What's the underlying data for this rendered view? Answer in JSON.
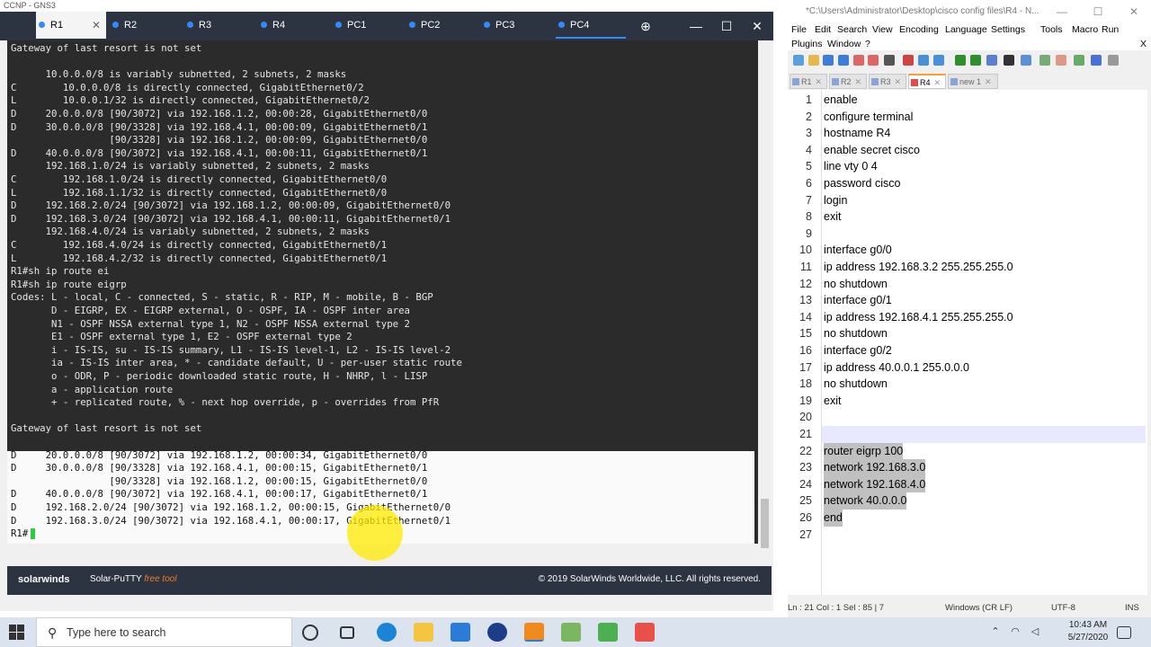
{
  "putty": {
    "window_title": "CCNP - GNS3",
    "tabs": [
      {
        "label": "R1",
        "active": true
      },
      {
        "label": "R2"
      },
      {
        "label": "R3"
      },
      {
        "label": "R4"
      },
      {
        "label": "PC1"
      },
      {
        "label": "PC2"
      },
      {
        "label": "PC3"
      },
      {
        "label": "PC4"
      }
    ],
    "add_tab": "⊕",
    "min": "—",
    "max": "☐",
    "close": "✕",
    "terminal_lines": [
      "Gateway of last resort is not set",
      "",
      "      10.0.0.0/8 is variably subnetted, 2 subnets, 2 masks",
      "C        10.0.0.0/8 is directly connected, GigabitEthernet0/2",
      "L        10.0.0.1/32 is directly connected, GigabitEthernet0/2",
      "D     20.0.0.0/8 [90/3072] via 192.168.1.2, 00:00:28, GigabitEthernet0/0",
      "D     30.0.0.0/8 [90/3328] via 192.168.4.1, 00:00:09, GigabitEthernet0/1",
      "                 [90/3328] via 192.168.1.2, 00:00:09, GigabitEthernet0/0",
      "D     40.0.0.0/8 [90/3072] via 192.168.4.1, 00:00:11, GigabitEthernet0/1",
      "      192.168.1.0/24 is variably subnetted, 2 subnets, 2 masks",
      "C        192.168.1.0/24 is directly connected, GigabitEthernet0/0",
      "L        192.168.1.1/32 is directly connected, GigabitEthernet0/0",
      "D     192.168.2.0/24 [90/3072] via 192.168.1.2, 00:00:09, GigabitEthernet0/0",
      "D     192.168.3.0/24 [90/3072] via 192.168.4.1, 00:00:11, GigabitEthernet0/1",
      "      192.168.4.0/24 is variably subnetted, 2 subnets, 2 masks",
      "C        192.168.4.0/24 is directly connected, GigabitEthernet0/1",
      "L        192.168.4.2/32 is directly connected, GigabitEthernet0/1",
      "R1#sh ip route ei",
      "R1#sh ip route eigrp",
      "Codes: L - local, C - connected, S - static, R - RIP, M - mobile, B - BGP",
      "       D - EIGRP, EX - EIGRP external, O - OSPF, IA - OSPF inter area",
      "       N1 - OSPF NSSA external type 1, N2 - OSPF NSSA external type 2",
      "       E1 - OSPF external type 1, E2 - OSPF external type 2",
      "       i - IS-IS, su - IS-IS summary, L1 - IS-IS level-1, L2 - IS-IS level-2",
      "       ia - IS-IS inter area, * - candidate default, U - per-user static route",
      "       o - ODR, P - periodic downloaded static route, H - NHRP, l - LISP",
      "       a - application route",
      "       + - replicated route, % - next hop override, p - overrides from PfR",
      "",
      "Gateway of last resort is not set",
      "",
      "D     20.0.0.0/8 [90/3072] via 192.168.1.2, 00:00:34, GigabitEthernet0/0",
      "D     30.0.0.0/8 [90/3328] via 192.168.4.1, 00:00:15, GigabitEthernet0/1",
      "                 [90/3328] via 192.168.1.2, 00:00:15, GigabitEthernet0/0",
      "D     40.0.0.0/8 [90/3072] via 192.168.4.1, 00:00:17, GigabitEthernet0/1",
      "D     192.168.2.0/24 [90/3072] via 192.168.1.2, 00:00:15, GigabitEthernet0/0",
      "D     192.168.3.0/24 [90/3072] via 192.168.4.1, 00:00:17, GigabitEthernet0/1",
      "R1#"
    ],
    "footer_brand": "solarwinds",
    "footer_product": "Solar-PuTTY",
    "footer_free": "free tool",
    "footer_copyright": "© 2019 SolarWinds Worldwide, LLC. All rights reserved."
  },
  "npp": {
    "title": "*C:\\Users\\Administrator\\Desktop\\cisco config files\\R4 - N...",
    "menu_row1": [
      "File",
      "Edit",
      "Search",
      "View",
      "Encoding",
      "Language",
      "Settings",
      "Tools",
      "Macro",
      "Run"
    ],
    "menu_row2": [
      "Plugins",
      "Window",
      "?"
    ],
    "menu_close": "X",
    "tabs": [
      {
        "label": "R1"
      },
      {
        "label": "R2"
      },
      {
        "label": "R3"
      },
      {
        "label": "R4",
        "active": true
      },
      {
        "label": "new 1"
      }
    ],
    "lines": [
      "enable",
      "configure terminal",
      "hostname R4",
      "enable secret cisco",
      "line vty 0 4",
      "password cisco",
      "login",
      "exit",
      "",
      "interface g0/0",
      "ip address 192.168.3.2 255.255.255.0",
      "no shutdown",
      "interface g0/1",
      "ip address 192.168.4.1 255.255.255.0",
      "no shutdown",
      "interface g0/2",
      "ip address 40.0.0.1 255.0.0.0",
      "no shutdown",
      "exit",
      "",
      "",
      "router eigrp 100",
      "network 192.168.3.0",
      "network 192.168.4.0",
      "network 40.0.0.0",
      "end",
      ""
    ],
    "status": {
      "pos": "Ln : 21   Col : 1   Sel : 85 | 7",
      "eol": "Windows (CR LF)",
      "encoding": "UTF-8",
      "mode": "INS"
    }
  },
  "taskbar": {
    "search_placeholder": "Type here to search",
    "time": "10:43 AM",
    "date": "5/27/2020"
  }
}
